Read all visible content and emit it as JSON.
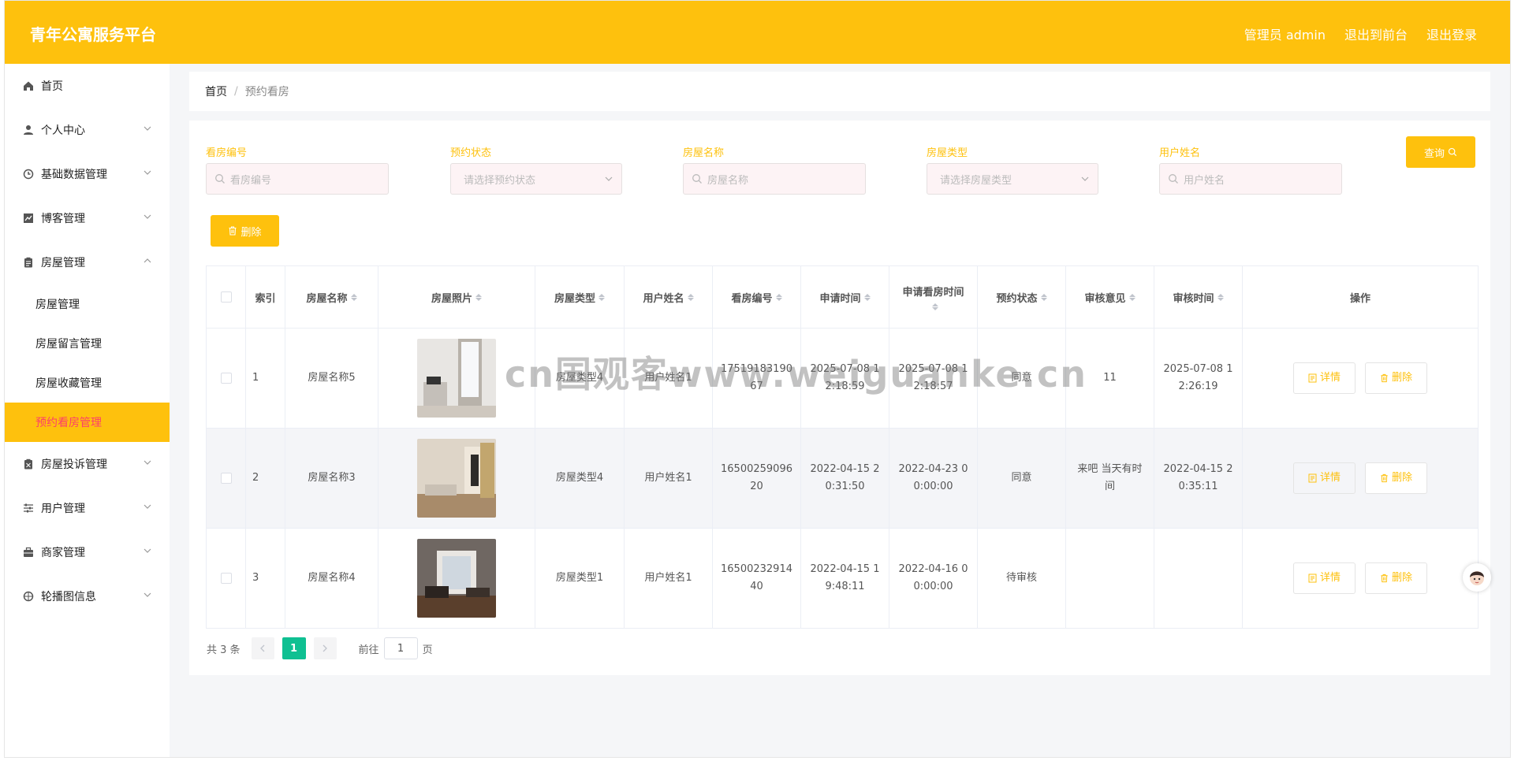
{
  "app": {
    "title": "青年公寓服务平台",
    "header_links": [
      "管理员 admin",
      "退出到前台",
      "退出登录"
    ]
  },
  "colors": {
    "accent": "#fec10d",
    "active_text": "#fe3e6b",
    "pager_active": "#0fc092"
  },
  "sidebar": {
    "items": [
      {
        "label": "首页",
        "icon": "home-icon"
      },
      {
        "label": "个人中心",
        "icon": "user-icon"
      },
      {
        "label": "基础数据管理",
        "icon": "clock-icon"
      },
      {
        "label": "博客管理",
        "icon": "chart-icon"
      },
      {
        "label": "房屋管理",
        "icon": "clipboard-icon"
      },
      {
        "label": "房屋投诉管理",
        "icon": "clipboard-icon"
      },
      {
        "label": "用户管理",
        "icon": "sliders-icon"
      },
      {
        "label": "商家管理",
        "icon": "briefcase-icon"
      },
      {
        "label": "轮播图信息",
        "icon": "compass-icon"
      }
    ],
    "submenu": [
      "房屋管理",
      "房屋留言管理",
      "房屋收藏管理",
      "预约看房管理"
    ]
  },
  "breadcrumb": {
    "home": "首页",
    "sep": "/",
    "current": "预约看房"
  },
  "filters": {
    "f1": {
      "label": "看房编号",
      "placeholder": "看房编号"
    },
    "f2": {
      "label": "预约状态",
      "placeholder": "请选择预约状态"
    },
    "f3": {
      "label": "房屋名称",
      "placeholder": "房屋名称"
    },
    "f4": {
      "label": "房屋类型",
      "placeholder": "请选择房屋类型"
    },
    "f5": {
      "label": "用户姓名",
      "placeholder": "用户姓名"
    }
  },
  "buttons": {
    "query": "查询",
    "delete": "删除",
    "detail": "详情"
  },
  "table": {
    "columns": [
      "索引",
      "房屋名称",
      "房屋照片",
      "房屋类型",
      "用户姓名",
      "看房编号",
      "申请时间",
      "申请看房时间",
      "预约状态",
      "审核意见",
      "审核时间",
      "操作"
    ],
    "rows": [
      {
        "index": "1",
        "name": "房屋名称5",
        "type": "房屋类型4",
        "user": "用户姓名1",
        "code": "1751918319067",
        "apply_time": "2025-07-08 12:18:59",
        "view_time": "2025-07-08 12:18:57",
        "status": "同意",
        "opinion": "11",
        "review_time": "2025-07-08 12:26:19"
      },
      {
        "index": "2",
        "name": "房屋名称3",
        "type": "房屋类型4",
        "user": "用户姓名1",
        "code": "1650025909620",
        "apply_time": "2022-04-15 20:31:50",
        "view_time": "2022-04-23 00:00:00",
        "status": "同意",
        "opinion": "来吧 当天有时间",
        "review_time": "2022-04-15 20:35:11"
      },
      {
        "index": "3",
        "name": "房屋名称4",
        "type": "房屋类型1",
        "user": "用户姓名1",
        "code": "1650023291440",
        "apply_time": "2022-04-15 19:48:11",
        "view_time": "2022-04-16 00:00:00",
        "status": "待审核",
        "opinion": "",
        "review_time": ""
      }
    ]
  },
  "pager": {
    "total": "共 3 条",
    "page": "1",
    "goto_prefix": "前往",
    "goto_value": "1",
    "goto_suffix": "页"
  },
  "watermark": "cn国观客www.weiguanke.cn"
}
